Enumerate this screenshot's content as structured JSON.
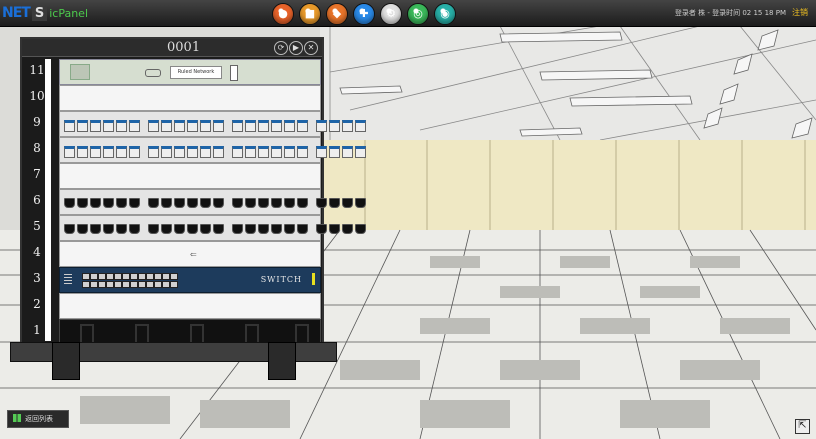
{
  "app": {
    "brand_prefix": "NET",
    "brand_s": "S",
    "brand_suffix": "icPanel"
  },
  "toolbar": {
    "icons": [
      {
        "name": "user-icon",
        "color": "#e8632a",
        "glyph": "●"
      },
      {
        "name": "docs-icon",
        "color": "#e89a2a",
        "glyph": "■"
      },
      {
        "name": "layers-icon",
        "color": "#e8742a",
        "glyph": "◆"
      },
      {
        "name": "refresh-icon",
        "color": "#2a8ae8",
        "glyph": "✚"
      },
      {
        "name": "settings-icon",
        "color": "#e0e0e0",
        "glyph": "⚙"
      },
      {
        "name": "search-icon",
        "color": "#3ab85a",
        "glyph": "◎"
      },
      {
        "name": "network-icon",
        "color": "#28b0a8",
        "glyph": "◉"
      }
    ]
  },
  "status": {
    "user_text": "登录者 株 - 登录时间 02 15 18 PM",
    "logout_label": "注销"
  },
  "rack": {
    "title": "0001",
    "units": [
      "11",
      "10",
      "9",
      "8",
      "7",
      "6",
      "5",
      "4",
      "3",
      "2",
      "1"
    ],
    "u11_plate": "Ruled Network",
    "switch_label": "SWITCH"
  },
  "bottom": {
    "button_label": "返回列表"
  },
  "colors": {
    "accent_blue": "#1e64a8",
    "switch_blue": "#1d3b5c"
  }
}
